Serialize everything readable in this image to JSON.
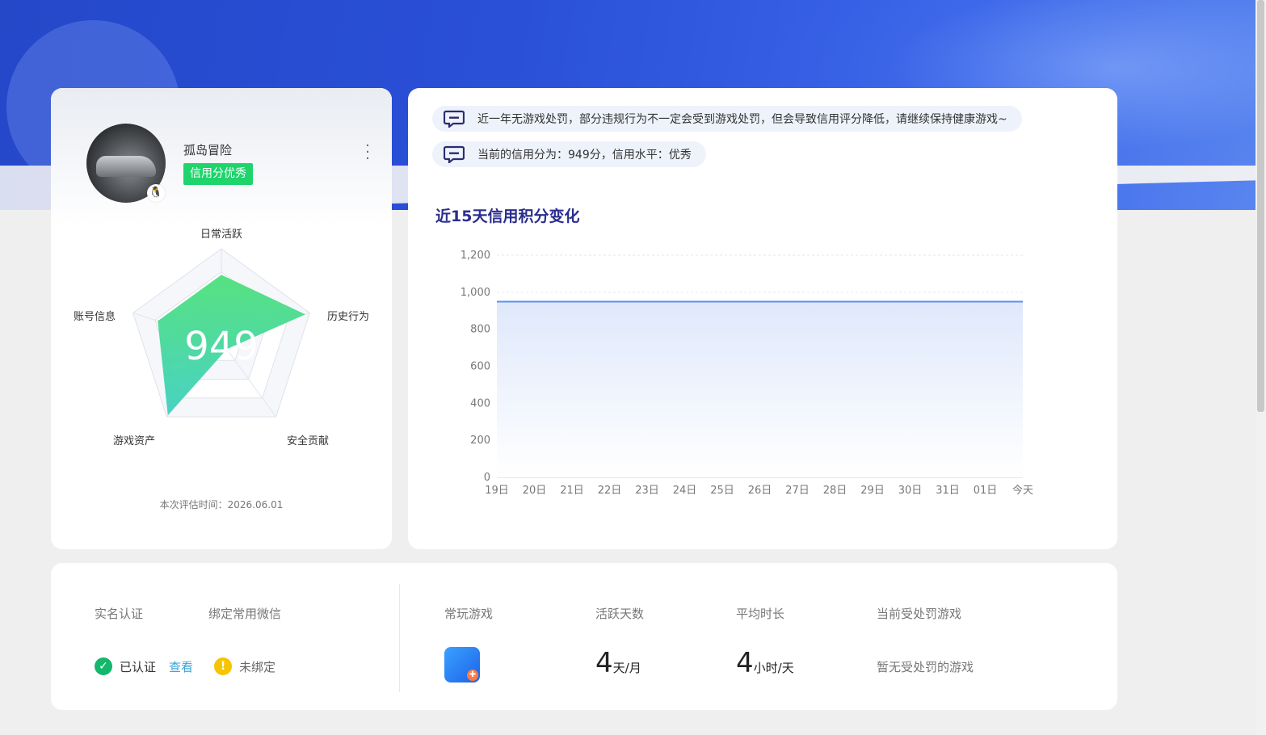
{
  "profile": {
    "username": "孤岛冒险",
    "credit_tag": "信用分优秀",
    "score": "949",
    "radar_labels": [
      "日常活跃",
      "历史行为",
      "安全贡献",
      "游戏资产",
      "账号信息"
    ],
    "radar_values": [
      0.72,
      0.95,
      0.1,
      0.98,
      0.72
    ],
    "eval_time": "本次评估时间：2026.06.01"
  },
  "notices": [
    {
      "text": "近一年无游戏处罚，部分违规行为不一定会受到游戏处罚，但会导致信用评分降低，请继续保持健康游戏~"
    },
    {
      "text": "当前的信用分为：949分，信用水平：优秀"
    }
  ],
  "chart_data": {
    "type": "area",
    "title": "近15天信用积分变化",
    "categories": [
      "19日",
      "20日",
      "21日",
      "22日",
      "23日",
      "24日",
      "25日",
      "26日",
      "27日",
      "28日",
      "29日",
      "30日",
      "31日",
      "01日",
      "今天"
    ],
    "values": [
      949,
      949,
      949,
      949,
      949,
      949,
      949,
      949,
      949,
      949,
      949,
      949,
      949,
      949,
      949
    ],
    "yticks": [
      "0",
      "200",
      "400",
      "600",
      "800",
      "1,000",
      "1,200"
    ],
    "ylim": [
      0,
      1200
    ],
    "grid": true,
    "colors": {
      "line": "#5b8ff0",
      "fill_top": "#dfe8fb",
      "fill_bottom": "#ffffff"
    }
  },
  "stats": {
    "realname_head": "实名认证",
    "wechat_head": "绑定常用微信",
    "verified_text": "已认证",
    "view_link": "查看",
    "unbound_text": "未绑定",
    "game_head": "常玩游戏",
    "active_head": "活跃天数",
    "active_num": "4",
    "active_unit": "天/月",
    "duration_head": "平均时长",
    "duration_num": "4",
    "duration_unit": "小时/天",
    "punish_head": "当前受处罚游戏",
    "punish_text": "暂无受处罚的游戏"
  },
  "icons": {
    "check": "✓",
    "warn": "!",
    "qq": "🐧"
  }
}
